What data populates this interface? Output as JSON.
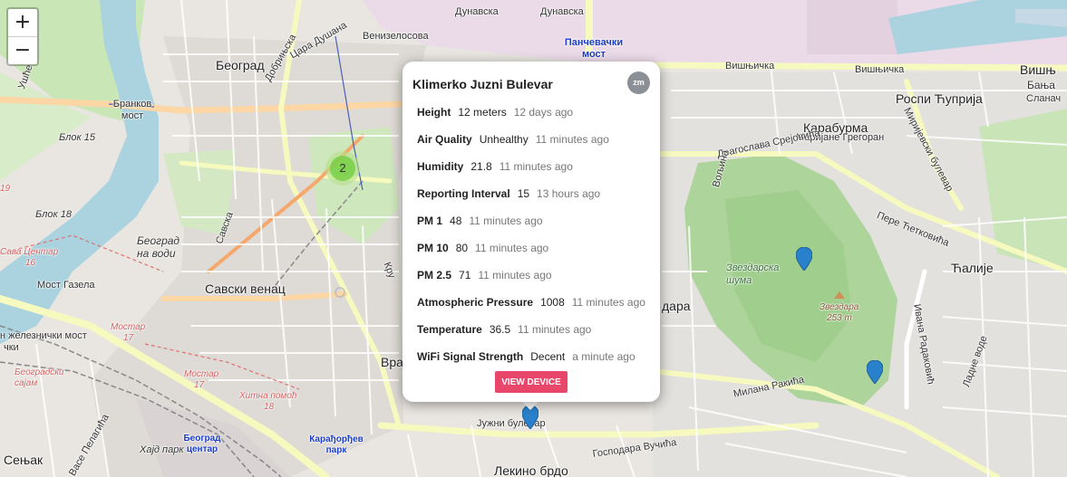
{
  "zoom": {
    "in_label": "+",
    "out_label": "−"
  },
  "cluster": {
    "count": "2"
  },
  "popup": {
    "title": "Klimerko Juzni Bulevar",
    "badge": "zm",
    "rows": [
      {
        "label": "Height",
        "value": "12 meters",
        "time": "12 days ago"
      },
      {
        "label": "Air Quality",
        "value": "Unhealthy",
        "time": "11 minutes ago"
      },
      {
        "label": "Humidity",
        "value": "21.8",
        "time": "11 minutes ago"
      },
      {
        "label": "Reporting Interval",
        "value": "15",
        "time": "13 hours ago"
      },
      {
        "label": "PM 1",
        "value": "48",
        "time": "11 minutes ago"
      },
      {
        "label": "PM 10",
        "value": "80",
        "time": "11 minutes ago"
      },
      {
        "label": "PM 2.5",
        "value": "71",
        "time": "11 minutes ago"
      },
      {
        "label": "Atmospheric Pressure",
        "value": "1008",
        "time": "11 minutes ago"
      },
      {
        "label": "Temperature",
        "value": "36.5",
        "time": "11 minutes ago"
      },
      {
        "label": "WiFi Signal Strength",
        "value": "Decent",
        "time": "a minute ago"
      }
    ],
    "button_label": "VIEW DEVICE",
    "button_color": "#e8466a"
  },
  "map_labels": {
    "beograd": "Београд",
    "dunavska1": "Дунавска",
    "dunavska2": "Дунавска",
    "venizelosova": "Венизелосова",
    "dobrinjska": "Добрињска",
    "cara_dusana": "Цара Душана",
    "pancevacki_most": "Панчевачки мост",
    "visnjicka1": "Вишњичка",
    "visnjicka2": "Вишњичка",
    "visnj_corner": "Вишњ",
    "banja": "Бањa",
    "slanac": "Сланач",
    "rospi_cuprija": "Роспи Ћуприја",
    "karaburma": "Карабурма",
    "marijane_gregoran": "Маријане Грегоран",
    "dragoslava_srejovica": "Драгослава Срејовића",
    "mirijevski_bulevar": "Миријевски булевар",
    "pere_cetkovica": "Пере Ћетковића",
    "voljina": "Вољина",
    "zvezdarska_suma": "Звездарска шума",
    "zvezdara": "Звездара",
    "zvezdara_elev": "253 m",
    "caliye": "Ћалије",
    "ivana_radakovica": "Ивана Радаковић",
    "ladne_vode": "Ладне воде",
    "milana_rakica": "Милана Ракића",
    "juzni_bulevar": "Јужни булевар",
    "gospodara_vucica": "Господара Вучића",
    "lokino_brdo": "Лекино брдо",
    "branko_most": "Бранков мост",
    "blok15": "Блок 15",
    "blok18": "Блок 18",
    "sava_centar": "Сава Центар",
    "beograd_na_vodi": "Београд на води",
    "most_gazela": "Мост Газела",
    "savski_venac": "Савски венац",
    "savska": "Савска",
    "mostar": "Мостар",
    "mostar2": "Мостар",
    "zelezn_most": "н железнички мост",
    "beogradski_sajam": "Београдски сајам",
    "hitna_pomoc": "Хитна помоћ",
    "hitna_num": "18",
    "beograd_centar": "Београд центар",
    "karadjordjev_park": "Карађорђев парк",
    "sencak": "Сењак",
    "vase_pelagica": "Васе Пелагића",
    "hajd_park": "Хајд парк",
    "vracar": "Врач",
    "dara": "дара",
    "kru": "Кру",
    "usce": "Ушће",
    "num16": "16",
    "num17": "17",
    "num17b": "17",
    "num19": "19",
    "num_left": "чки"
  },
  "colors": {
    "water": "#aad3df",
    "park": "#c8e6b6",
    "forest": "#a9d39a",
    "residential": "#e0dfdf",
    "industrial": "#ebdbe8",
    "road_major": "#fcd6a4",
    "road_primary": "#f7fabf",
    "rail": "#777777",
    "marker": "#2a81cb",
    "cluster": "#6ecc39"
  }
}
